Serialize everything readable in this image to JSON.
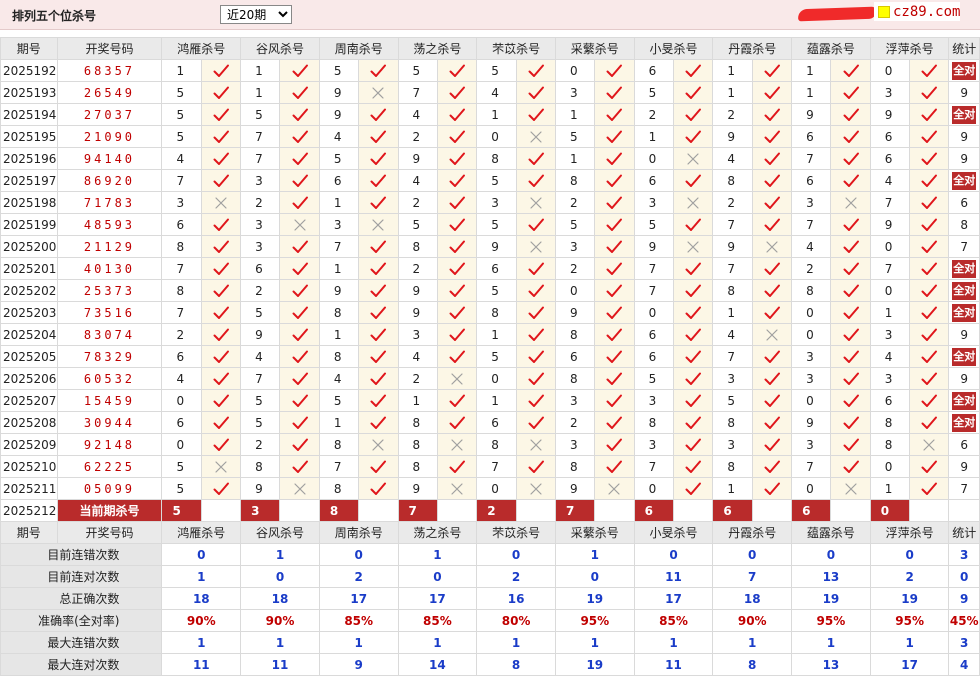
{
  "header": {
    "title": "排列五个位杀号",
    "period_select": "近20期",
    "logo_text": "cz89.com"
  },
  "columns": [
    "期号",
    "开奖号码",
    "鸿雁杀号",
    "谷风杀号",
    "周南杀号",
    "荡之杀号",
    "芣苡杀号",
    "采蘩杀号",
    "小旻杀号",
    "丹霞杀号",
    "蕴露杀号",
    "浮萍杀号",
    "统计"
  ],
  "all_right_label": "全对",
  "rows": [
    {
      "issue": "2025192",
      "win": "68357",
      "kills": [
        [
          1,
          1
        ],
        [
          1,
          1
        ],
        [
          5,
          1
        ],
        [
          5,
          1
        ],
        [
          5,
          1
        ],
        [
          0,
          1
        ],
        [
          6,
          1
        ],
        [
          1,
          1
        ],
        [
          1,
          1
        ],
        [
          0,
          1
        ]
      ],
      "stat": "全对"
    },
    {
      "issue": "2025193",
      "win": "26549",
      "kills": [
        [
          5,
          1
        ],
        [
          1,
          1
        ],
        [
          9,
          0
        ],
        [
          7,
          1
        ],
        [
          4,
          1
        ],
        [
          3,
          1
        ],
        [
          5,
          1
        ],
        [
          1,
          1
        ],
        [
          1,
          1
        ],
        [
          3,
          1
        ]
      ],
      "stat": "9"
    },
    {
      "issue": "2025194",
      "win": "27037",
      "kills": [
        [
          5,
          1
        ],
        [
          5,
          1
        ],
        [
          9,
          1
        ],
        [
          4,
          1
        ],
        [
          1,
          1
        ],
        [
          1,
          1
        ],
        [
          2,
          1
        ],
        [
          2,
          1
        ],
        [
          9,
          1
        ],
        [
          9,
          1
        ]
      ],
      "stat": "全对"
    },
    {
      "issue": "2025195",
      "win": "21090",
      "kills": [
        [
          5,
          1
        ],
        [
          7,
          1
        ],
        [
          4,
          1
        ],
        [
          2,
          1
        ],
        [
          0,
          0
        ],
        [
          5,
          1
        ],
        [
          1,
          1
        ],
        [
          9,
          1
        ],
        [
          6,
          1
        ],
        [
          6,
          1
        ]
      ],
      "stat": "9"
    },
    {
      "issue": "2025196",
      "win": "94140",
      "kills": [
        [
          4,
          1
        ],
        [
          7,
          1
        ],
        [
          5,
          1
        ],
        [
          9,
          1
        ],
        [
          8,
          1
        ],
        [
          1,
          1
        ],
        [
          0,
          0
        ],
        [
          4,
          1
        ],
        [
          7,
          1
        ],
        [
          6,
          1
        ]
      ],
      "stat": "9"
    },
    {
      "issue": "2025197",
      "win": "86920",
      "kills": [
        [
          7,
          1
        ],
        [
          3,
          1
        ],
        [
          6,
          1
        ],
        [
          4,
          1
        ],
        [
          5,
          1
        ],
        [
          8,
          1
        ],
        [
          6,
          1
        ],
        [
          8,
          1
        ],
        [
          6,
          1
        ],
        [
          4,
          1
        ]
      ],
      "stat": "全对"
    },
    {
      "issue": "2025198",
      "win": "71783",
      "kills": [
        [
          3,
          0
        ],
        [
          2,
          1
        ],
        [
          1,
          1
        ],
        [
          2,
          1
        ],
        [
          3,
          0
        ],
        [
          2,
          1
        ],
        [
          3,
          0
        ],
        [
          2,
          1
        ],
        [
          3,
          0
        ],
        [
          7,
          1
        ]
      ],
      "stat": "6"
    },
    {
      "issue": "2025199",
      "win": "48593",
      "kills": [
        [
          6,
          1
        ],
        [
          3,
          0
        ],
        [
          3,
          0
        ],
        [
          5,
          1
        ],
        [
          5,
          1
        ],
        [
          5,
          1
        ],
        [
          5,
          1
        ],
        [
          7,
          1
        ],
        [
          7,
          1
        ],
        [
          9,
          1
        ]
      ],
      "stat": "8"
    },
    {
      "issue": "2025200",
      "win": "21129",
      "kills": [
        [
          8,
          1
        ],
        [
          3,
          1
        ],
        [
          7,
          1
        ],
        [
          8,
          1
        ],
        [
          9,
          0
        ],
        [
          3,
          1
        ],
        [
          9,
          0
        ],
        [
          9,
          0
        ],
        [
          4,
          1
        ],
        [
          0,
          1
        ]
      ],
      "stat": "7"
    },
    {
      "issue": "2025201",
      "win": "40130",
      "kills": [
        [
          7,
          1
        ],
        [
          6,
          1
        ],
        [
          1,
          1
        ],
        [
          2,
          1
        ],
        [
          6,
          1
        ],
        [
          2,
          1
        ],
        [
          7,
          1
        ],
        [
          7,
          1
        ],
        [
          2,
          1
        ],
        [
          7,
          1
        ]
      ],
      "stat": "全对"
    },
    {
      "issue": "2025202",
      "win": "25373",
      "kills": [
        [
          8,
          1
        ],
        [
          2,
          1
        ],
        [
          9,
          1
        ],
        [
          9,
          1
        ],
        [
          5,
          1
        ],
        [
          0,
          1
        ],
        [
          7,
          1
        ],
        [
          8,
          1
        ],
        [
          8,
          1
        ],
        [
          0,
          1
        ]
      ],
      "stat": "全对"
    },
    {
      "issue": "2025203",
      "win": "73516",
      "kills": [
        [
          7,
          1
        ],
        [
          5,
          1
        ],
        [
          8,
          1
        ],
        [
          9,
          1
        ],
        [
          8,
          1
        ],
        [
          9,
          1
        ],
        [
          0,
          1
        ],
        [
          1,
          1
        ],
        [
          0,
          1
        ],
        [
          1,
          1
        ]
      ],
      "stat": "全对"
    },
    {
      "issue": "2025204",
      "win": "83074",
      "kills": [
        [
          2,
          1
        ],
        [
          9,
          1
        ],
        [
          1,
          1
        ],
        [
          3,
          1
        ],
        [
          1,
          1
        ],
        [
          8,
          1
        ],
        [
          6,
          1
        ],
        [
          4,
          0
        ],
        [
          0,
          1
        ],
        [
          3,
          1
        ]
      ],
      "stat": "9"
    },
    {
      "issue": "2025205",
      "win": "78329",
      "kills": [
        [
          6,
          1
        ],
        [
          4,
          1
        ],
        [
          8,
          1
        ],
        [
          4,
          1
        ],
        [
          5,
          1
        ],
        [
          6,
          1
        ],
        [
          6,
          1
        ],
        [
          7,
          1
        ],
        [
          3,
          1
        ],
        [
          4,
          1
        ]
      ],
      "stat": "全对"
    },
    {
      "issue": "2025206",
      "win": "60532",
      "kills": [
        [
          4,
          1
        ],
        [
          7,
          1
        ],
        [
          4,
          1
        ],
        [
          2,
          0
        ],
        [
          0,
          1
        ],
        [
          8,
          1
        ],
        [
          5,
          1
        ],
        [
          3,
          1
        ],
        [
          3,
          1
        ],
        [
          3,
          1
        ]
      ],
      "stat": "9"
    },
    {
      "issue": "2025207",
      "win": "15459",
      "kills": [
        [
          0,
          1
        ],
        [
          5,
          1
        ],
        [
          5,
          1
        ],
        [
          1,
          1
        ],
        [
          1,
          1
        ],
        [
          3,
          1
        ],
        [
          3,
          1
        ],
        [
          5,
          1
        ],
        [
          0,
          1
        ],
        [
          6,
          1
        ]
      ],
      "stat": "全对"
    },
    {
      "issue": "2025208",
      "win": "30944",
      "kills": [
        [
          6,
          1
        ],
        [
          5,
          1
        ],
        [
          1,
          1
        ],
        [
          8,
          1
        ],
        [
          6,
          1
        ],
        [
          2,
          1
        ],
        [
          8,
          1
        ],
        [
          8,
          1
        ],
        [
          9,
          1
        ],
        [
          8,
          1
        ]
      ],
      "stat": "全对"
    },
    {
      "issue": "2025209",
      "win": "92148",
      "kills": [
        [
          0,
          1
        ],
        [
          2,
          1
        ],
        [
          8,
          0
        ],
        [
          8,
          0
        ],
        [
          8,
          0
        ],
        [
          3,
          1
        ],
        [
          3,
          1
        ],
        [
          3,
          1
        ],
        [
          3,
          1
        ],
        [
          8,
          0
        ]
      ],
      "stat": "6"
    },
    {
      "issue": "2025210",
      "win": "62225",
      "kills": [
        [
          5,
          0
        ],
        [
          8,
          1
        ],
        [
          7,
          1
        ],
        [
          8,
          1
        ],
        [
          7,
          1
        ],
        [
          8,
          1
        ],
        [
          7,
          1
        ],
        [
          8,
          1
        ],
        [
          7,
          1
        ],
        [
          0,
          1
        ]
      ],
      "stat": "9"
    },
    {
      "issue": "2025211",
      "win": "05099",
      "kills": [
        [
          5,
          1
        ],
        [
          9,
          0
        ],
        [
          8,
          1
        ],
        [
          9,
          0
        ],
        [
          0,
          0
        ],
        [
          9,
          0
        ],
        [
          0,
          1
        ],
        [
          1,
          1
        ],
        [
          0,
          0
        ],
        [
          1,
          1
        ]
      ],
      "stat": "7"
    }
  ],
  "current": {
    "issue": "2025212",
    "label": "当前期杀号",
    "kills": [
      "5",
      "3",
      "8",
      "7",
      "2",
      "7",
      "6",
      "6",
      "6",
      "0"
    ]
  },
  "stats": [
    {
      "label": "目前连错次数",
      "values": [
        "0",
        "1",
        "0",
        "1",
        "0",
        "1",
        "0",
        "0",
        "0",
        "0",
        "3"
      ],
      "red": false
    },
    {
      "label": "目前连对次数",
      "values": [
        "1",
        "0",
        "2",
        "0",
        "2",
        "0",
        "11",
        "7",
        "13",
        "2",
        "0"
      ],
      "red": false
    },
    {
      "label": "总正确次数",
      "values": [
        "18",
        "18",
        "17",
        "17",
        "16",
        "19",
        "17",
        "18",
        "19",
        "19",
        "9"
      ],
      "red": false
    },
    {
      "label": "准确率(全对率)",
      "values": [
        "90%",
        "90%",
        "85%",
        "85%",
        "80%",
        "95%",
        "85%",
        "90%",
        "95%",
        "95%",
        "45%"
      ],
      "red": true
    },
    {
      "label": "最大连错次数",
      "values": [
        "1",
        "1",
        "1",
        "1",
        "1",
        "1",
        "1",
        "1",
        "1",
        "1",
        "3"
      ],
      "red": false
    },
    {
      "label": "最大连对次数",
      "values": [
        "11",
        "11",
        "9",
        "14",
        "8",
        "19",
        "11",
        "8",
        "13",
        "17",
        "4"
      ],
      "red": false
    }
  ]
}
